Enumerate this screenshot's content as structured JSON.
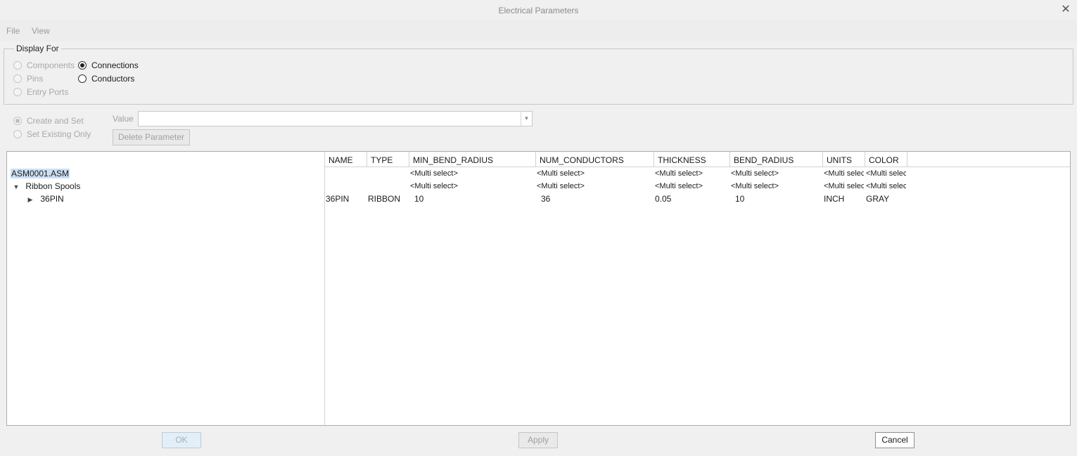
{
  "window": {
    "title": "Electrical Parameters",
    "close_glyph": "✕"
  },
  "menu": {
    "file": "File",
    "view": "View"
  },
  "display_for": {
    "legend": "Display For",
    "options": [
      {
        "label": "Components",
        "checked": false,
        "enabled": false
      },
      {
        "label": "Pins",
        "checked": false,
        "enabled": false
      },
      {
        "label": "Entry Ports",
        "checked": false,
        "enabled": false
      },
      {
        "label": "Connections",
        "checked": true,
        "enabled": true
      },
      {
        "label": "Conductors",
        "checked": false,
        "enabled": true
      }
    ]
  },
  "mode": {
    "options": [
      {
        "label": "Create and Set",
        "checked": true,
        "enabled": false
      },
      {
        "label": "Set Existing Only",
        "checked": false,
        "enabled": false
      }
    ]
  },
  "value": {
    "label": "Value",
    "current": ""
  },
  "delete_button": "Delete Parameter",
  "tree": {
    "root": "ASM0001.ASM",
    "group": "Ribbon Spools",
    "item": "36PIN"
  },
  "grid": {
    "columns": [
      "NAME",
      "TYPE",
      "MIN_BEND_RADIUS",
      "NUM_CONDUCTORS",
      "THICKNESS",
      "BEND_RADIUS",
      "UNITS",
      "COLOR"
    ],
    "rows": [
      [
        "",
        "",
        "<Multi select>",
        "<Multi select>",
        "<Multi select>",
        "<Multi select>",
        "<Multi select>",
        "<Multi select>"
      ],
      [
        "",
        "",
        "<Multi select>",
        "<Multi select>",
        "<Multi select>",
        "<Multi select>",
        "<Multi select>",
        "<Multi select>"
      ],
      [
        "36PIN",
        "RIBBON",
        "10",
        "36",
        "0.05",
        "10",
        "INCH",
        "GRAY"
      ]
    ]
  },
  "buttons": {
    "ok": "OK",
    "apply": "Apply",
    "cancel": "Cancel"
  }
}
